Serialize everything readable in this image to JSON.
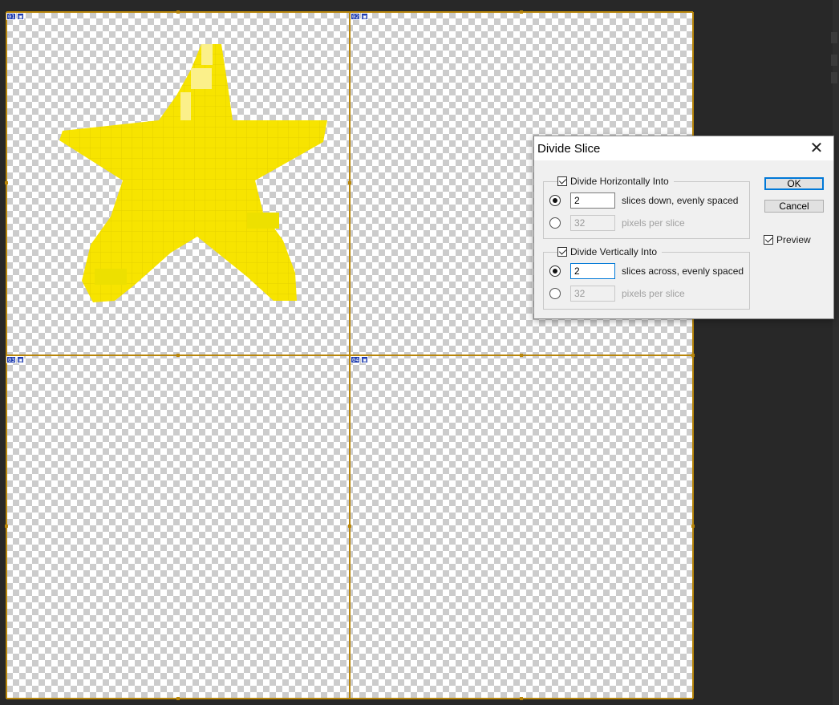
{
  "canvas": {
    "slices": [
      {
        "number": "01",
        "icon": "image-slice-icon"
      },
      {
        "number": "02",
        "icon": "image-slice-icon"
      },
      {
        "number": "03",
        "icon": "image-slice-icon"
      },
      {
        "number": "04",
        "icon": "image-slice-icon"
      }
    ],
    "guide_color": "#b8860b",
    "star_color": "#f7e400"
  },
  "dialog": {
    "title": "Divide Slice",
    "close_icon": "close-icon",
    "horizontal": {
      "checkbox_label": "Divide Horizontally Into",
      "checked": true,
      "slices_value": "2",
      "slices_label": "slices down, evenly spaced",
      "pixels_value": "32",
      "pixels_label": "pixels per slice"
    },
    "vertical": {
      "checkbox_label": "Divide Vertically Into",
      "checked": true,
      "slices_value": "2",
      "slices_label": "slices across, evenly spaced",
      "pixels_value": "32",
      "pixels_label": "pixels per slice"
    },
    "ok_label": "OK",
    "cancel_label": "Cancel",
    "preview_label": "Preview",
    "preview_checked": true
  }
}
